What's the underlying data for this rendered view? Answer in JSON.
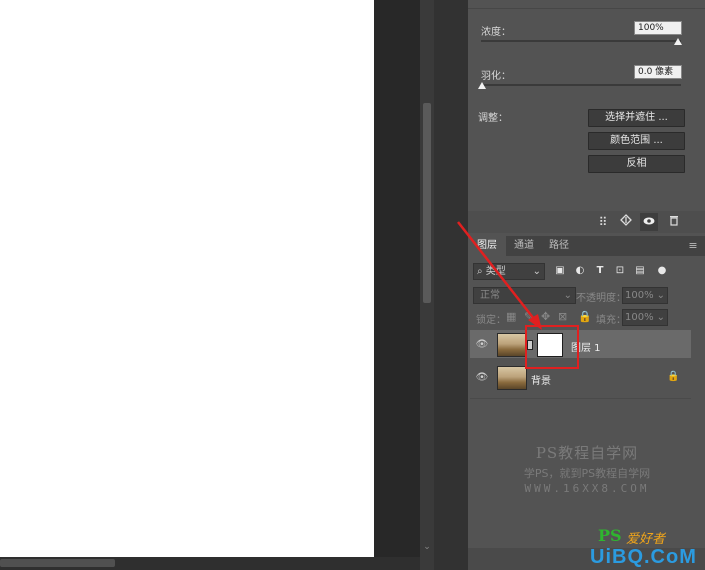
{
  "properties": {
    "density_label": "浓度：",
    "density_value": "100%",
    "feather_label": "羽化：",
    "feather_value": "0.0 像素",
    "adjust_label": "调整：",
    "select_mask_button": "选择并遮住 ...",
    "color_range_button": "颜色范围 ...",
    "invert_button": "反相",
    "density_level": 1.0,
    "feather_level": 0.0
  },
  "layers_panel": {
    "tabs": [
      "图层",
      "通道",
      "路径"
    ],
    "filter_label": "类型",
    "blend_mode": "正常",
    "opacity_label": "不透明度：",
    "opacity_value": "100%",
    "lock_label": "锁定：",
    "fill_label": "填充：",
    "fill_value": "100%",
    "layers": [
      {
        "name": "图层 1",
        "selected": true,
        "has_mask": true
      },
      {
        "name": "背景",
        "selected": false,
        "locked": true
      }
    ]
  },
  "watermark": {
    "line1": "PS教程自学网",
    "line2": "学PS，就到PS教程自学网",
    "line3": "WWW.16XX8.COM"
  },
  "logo": {
    "text": "UiBQ.CoM",
    "ps_text": "PS",
    "cn_text": "爱好者"
  },
  "colors": {
    "annotation": "#e02020",
    "panel_bg": "#535353",
    "selected_row": "#6a6a6a"
  },
  "icons": {
    "pixel_filter": "image-icon",
    "adjust_filter": "half-circle-icon",
    "type_filter": "text-T-icon",
    "shape_filter": "transform-icon",
    "smart_filter": "smart-object-icon",
    "filter_toggle": "dot-toggle-icon"
  }
}
